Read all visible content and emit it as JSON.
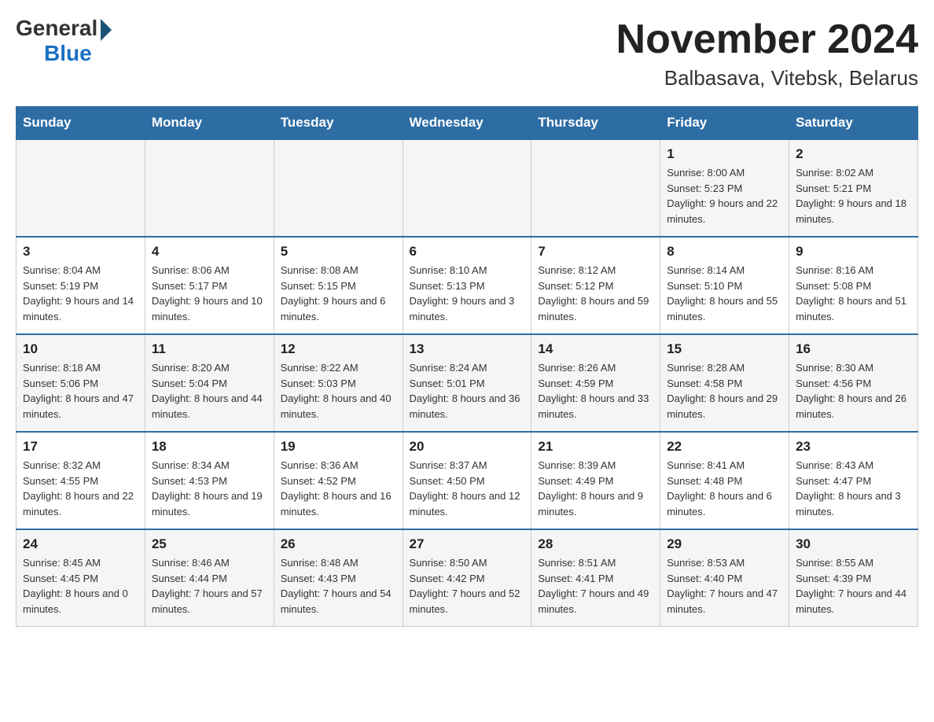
{
  "header": {
    "logo_general": "General",
    "logo_blue": "Blue",
    "title": "November 2024",
    "subtitle": "Balbasava, Vitebsk, Belarus"
  },
  "days_of_week": [
    "Sunday",
    "Monday",
    "Tuesday",
    "Wednesday",
    "Thursday",
    "Friday",
    "Saturday"
  ],
  "weeks": [
    [
      {
        "day": "",
        "sunrise": "",
        "sunset": "",
        "daylight": ""
      },
      {
        "day": "",
        "sunrise": "",
        "sunset": "",
        "daylight": ""
      },
      {
        "day": "",
        "sunrise": "",
        "sunset": "",
        "daylight": ""
      },
      {
        "day": "",
        "sunrise": "",
        "sunset": "",
        "daylight": ""
      },
      {
        "day": "",
        "sunrise": "",
        "sunset": "",
        "daylight": ""
      },
      {
        "day": "1",
        "sunrise": "Sunrise: 8:00 AM",
        "sunset": "Sunset: 5:23 PM",
        "daylight": "Daylight: 9 hours and 22 minutes."
      },
      {
        "day": "2",
        "sunrise": "Sunrise: 8:02 AM",
        "sunset": "Sunset: 5:21 PM",
        "daylight": "Daylight: 9 hours and 18 minutes."
      }
    ],
    [
      {
        "day": "3",
        "sunrise": "Sunrise: 8:04 AM",
        "sunset": "Sunset: 5:19 PM",
        "daylight": "Daylight: 9 hours and 14 minutes."
      },
      {
        "day": "4",
        "sunrise": "Sunrise: 8:06 AM",
        "sunset": "Sunset: 5:17 PM",
        "daylight": "Daylight: 9 hours and 10 minutes."
      },
      {
        "day": "5",
        "sunrise": "Sunrise: 8:08 AM",
        "sunset": "Sunset: 5:15 PM",
        "daylight": "Daylight: 9 hours and 6 minutes."
      },
      {
        "day": "6",
        "sunrise": "Sunrise: 8:10 AM",
        "sunset": "Sunset: 5:13 PM",
        "daylight": "Daylight: 9 hours and 3 minutes."
      },
      {
        "day": "7",
        "sunrise": "Sunrise: 8:12 AM",
        "sunset": "Sunset: 5:12 PM",
        "daylight": "Daylight: 8 hours and 59 minutes."
      },
      {
        "day": "8",
        "sunrise": "Sunrise: 8:14 AM",
        "sunset": "Sunset: 5:10 PM",
        "daylight": "Daylight: 8 hours and 55 minutes."
      },
      {
        "day": "9",
        "sunrise": "Sunrise: 8:16 AM",
        "sunset": "Sunset: 5:08 PM",
        "daylight": "Daylight: 8 hours and 51 minutes."
      }
    ],
    [
      {
        "day": "10",
        "sunrise": "Sunrise: 8:18 AM",
        "sunset": "Sunset: 5:06 PM",
        "daylight": "Daylight: 8 hours and 47 minutes."
      },
      {
        "day": "11",
        "sunrise": "Sunrise: 8:20 AM",
        "sunset": "Sunset: 5:04 PM",
        "daylight": "Daylight: 8 hours and 44 minutes."
      },
      {
        "day": "12",
        "sunrise": "Sunrise: 8:22 AM",
        "sunset": "Sunset: 5:03 PM",
        "daylight": "Daylight: 8 hours and 40 minutes."
      },
      {
        "day": "13",
        "sunrise": "Sunrise: 8:24 AM",
        "sunset": "Sunset: 5:01 PM",
        "daylight": "Daylight: 8 hours and 36 minutes."
      },
      {
        "day": "14",
        "sunrise": "Sunrise: 8:26 AM",
        "sunset": "Sunset: 4:59 PM",
        "daylight": "Daylight: 8 hours and 33 minutes."
      },
      {
        "day": "15",
        "sunrise": "Sunrise: 8:28 AM",
        "sunset": "Sunset: 4:58 PM",
        "daylight": "Daylight: 8 hours and 29 minutes."
      },
      {
        "day": "16",
        "sunrise": "Sunrise: 8:30 AM",
        "sunset": "Sunset: 4:56 PM",
        "daylight": "Daylight: 8 hours and 26 minutes."
      }
    ],
    [
      {
        "day": "17",
        "sunrise": "Sunrise: 8:32 AM",
        "sunset": "Sunset: 4:55 PM",
        "daylight": "Daylight: 8 hours and 22 minutes."
      },
      {
        "day": "18",
        "sunrise": "Sunrise: 8:34 AM",
        "sunset": "Sunset: 4:53 PM",
        "daylight": "Daylight: 8 hours and 19 minutes."
      },
      {
        "day": "19",
        "sunrise": "Sunrise: 8:36 AM",
        "sunset": "Sunset: 4:52 PM",
        "daylight": "Daylight: 8 hours and 16 minutes."
      },
      {
        "day": "20",
        "sunrise": "Sunrise: 8:37 AM",
        "sunset": "Sunset: 4:50 PM",
        "daylight": "Daylight: 8 hours and 12 minutes."
      },
      {
        "day": "21",
        "sunrise": "Sunrise: 8:39 AM",
        "sunset": "Sunset: 4:49 PM",
        "daylight": "Daylight: 8 hours and 9 minutes."
      },
      {
        "day": "22",
        "sunrise": "Sunrise: 8:41 AM",
        "sunset": "Sunset: 4:48 PM",
        "daylight": "Daylight: 8 hours and 6 minutes."
      },
      {
        "day": "23",
        "sunrise": "Sunrise: 8:43 AM",
        "sunset": "Sunset: 4:47 PM",
        "daylight": "Daylight: 8 hours and 3 minutes."
      }
    ],
    [
      {
        "day": "24",
        "sunrise": "Sunrise: 8:45 AM",
        "sunset": "Sunset: 4:45 PM",
        "daylight": "Daylight: 8 hours and 0 minutes."
      },
      {
        "day": "25",
        "sunrise": "Sunrise: 8:46 AM",
        "sunset": "Sunset: 4:44 PM",
        "daylight": "Daylight: 7 hours and 57 minutes."
      },
      {
        "day": "26",
        "sunrise": "Sunrise: 8:48 AM",
        "sunset": "Sunset: 4:43 PM",
        "daylight": "Daylight: 7 hours and 54 minutes."
      },
      {
        "day": "27",
        "sunrise": "Sunrise: 8:50 AM",
        "sunset": "Sunset: 4:42 PM",
        "daylight": "Daylight: 7 hours and 52 minutes."
      },
      {
        "day": "28",
        "sunrise": "Sunrise: 8:51 AM",
        "sunset": "Sunset: 4:41 PM",
        "daylight": "Daylight: 7 hours and 49 minutes."
      },
      {
        "day": "29",
        "sunrise": "Sunrise: 8:53 AM",
        "sunset": "Sunset: 4:40 PM",
        "daylight": "Daylight: 7 hours and 47 minutes."
      },
      {
        "day": "30",
        "sunrise": "Sunrise: 8:55 AM",
        "sunset": "Sunset: 4:39 PM",
        "daylight": "Daylight: 7 hours and 44 minutes."
      }
    ]
  ]
}
